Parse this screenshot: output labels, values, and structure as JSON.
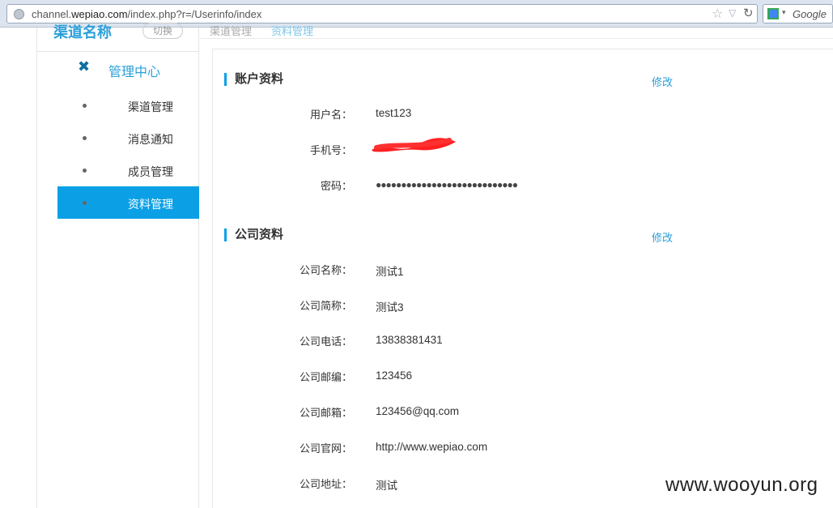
{
  "browser": {
    "url_prefix": "channel.",
    "url_domain": "wepiao.com",
    "url_path": "/index.php?r=/Userinfo/index",
    "search_engine": "Google"
  },
  "sidebar": {
    "channel_name": "渠道名称",
    "switch_label": "切换",
    "section_label": "管理中心",
    "items": [
      {
        "label": "渠道管理",
        "active": false
      },
      {
        "label": "消息通知",
        "active": false
      },
      {
        "label": "成员管理",
        "active": false
      },
      {
        "label": "资料管理",
        "active": true
      }
    ]
  },
  "breadcrumb": {
    "left": "渠道管理",
    "right": "资料管理"
  },
  "account": {
    "title": "账户资料",
    "edit_label": "修改",
    "rows": [
      {
        "label": "用户名：",
        "value": "test123"
      },
      {
        "label": "手机号：",
        "value": ""
      },
      {
        "label": "密码：",
        "value": "●●●●●●●●●●●●●●●●●●●●●●●●●●●●"
      }
    ]
  },
  "company": {
    "title": "公司资料",
    "edit_label": "修改",
    "rows": [
      {
        "label": "公司名称：",
        "value": "测试1"
      },
      {
        "label": "公司简称：",
        "value": "测试3"
      },
      {
        "label": "公司电话：",
        "value": "13838381431"
      },
      {
        "label": "公司邮编：",
        "value": "123456"
      },
      {
        "label": "公司邮箱：",
        "value": "123456@qq.com"
      },
      {
        "label": "公司官网：",
        "value": "http://www.wepiao.com"
      },
      {
        "label": "公司地址：",
        "value": "测试"
      }
    ]
  },
  "watermark": "www.wooyun.org",
  "colors": {
    "accent": "#0ba0e6",
    "link": "#2a9fd8",
    "redaction": "#ff2020"
  }
}
